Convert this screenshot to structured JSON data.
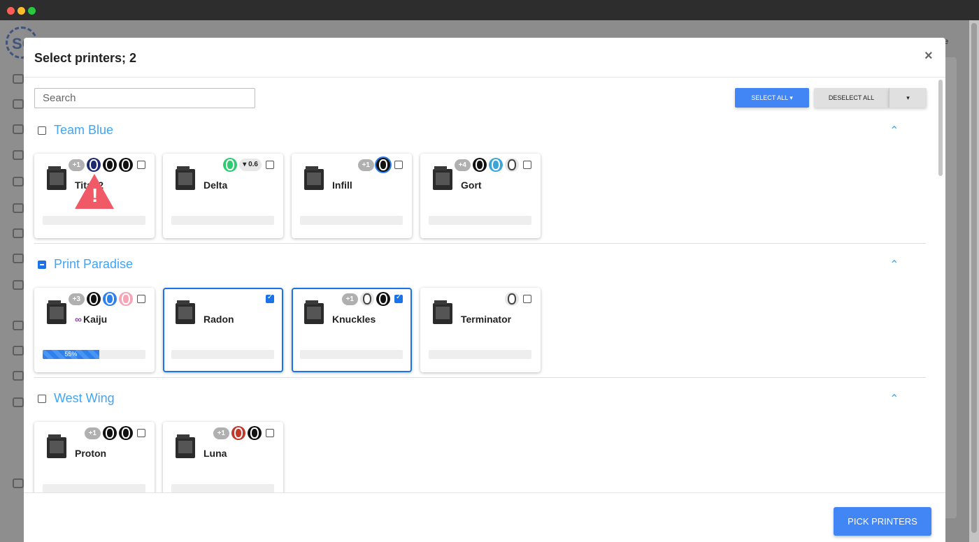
{
  "window": {
    "dot_colors": [
      "#ff5f57",
      "#febc2e",
      "#28c840"
    ]
  },
  "app": {
    "logo_text": "SC",
    "user_name": "name"
  },
  "dialog": {
    "title": "Select printers; 2",
    "close_label": "×",
    "search_placeholder": "Search",
    "select_all_label": "SELECT ALL ▾",
    "deselect_all_label": "DESELECT ALL",
    "split_caret": "▾",
    "pick_label": "PICK PRINTERS"
  },
  "groups": [
    {
      "label": "Team Blue",
      "checked": "none",
      "printers": [
        {
          "name": "Titan2",
          "checked": false,
          "extra": "+1",
          "spools": [
            "#1e2a6e",
            "#111111",
            "#111111"
          ],
          "warning": true
        },
        {
          "name": "Delta",
          "checked": false,
          "extra": "",
          "spools": [
            "#2ecc71"
          ],
          "nozzle": "0.6"
        },
        {
          "name": "Infill",
          "checked": false,
          "extra": "+1",
          "spools": [
            "#111111"
          ],
          "ring": true
        },
        {
          "name": "Gort",
          "checked": false,
          "extra": "+4",
          "spools": [
            "#111111",
            "#3ba5d8",
            "#ffffff"
          ]
        }
      ]
    },
    {
      "label": "Print Paradise",
      "checked": "partial",
      "printers": [
        {
          "name": "Kaiju",
          "checked": false,
          "extra": "+3",
          "spools": [
            "#111111",
            "#2f80ed",
            "#f4a6b6"
          ],
          "infinity": "∞",
          "progress": 55,
          "progress_label": "55%"
        },
        {
          "name": "Radon",
          "checked": true,
          "extra": "",
          "spools": []
        },
        {
          "name": "Knuckles",
          "checked": true,
          "extra": "+1",
          "spools": [
            "#ffffff",
            "#111111"
          ]
        },
        {
          "name": "Terminator",
          "checked": false,
          "extra": "",
          "spools": [
            "#ffffff"
          ]
        }
      ]
    },
    {
      "label": "West Wing",
      "checked": "none",
      "printers": [
        {
          "name": "Proton",
          "checked": false,
          "extra": "+1",
          "spools": [
            "#111111",
            "#111111"
          ]
        },
        {
          "name": "Luna",
          "checked": false,
          "extra": "+1",
          "spools": [
            "#c0392b",
            "#111111"
          ]
        }
      ]
    }
  ]
}
